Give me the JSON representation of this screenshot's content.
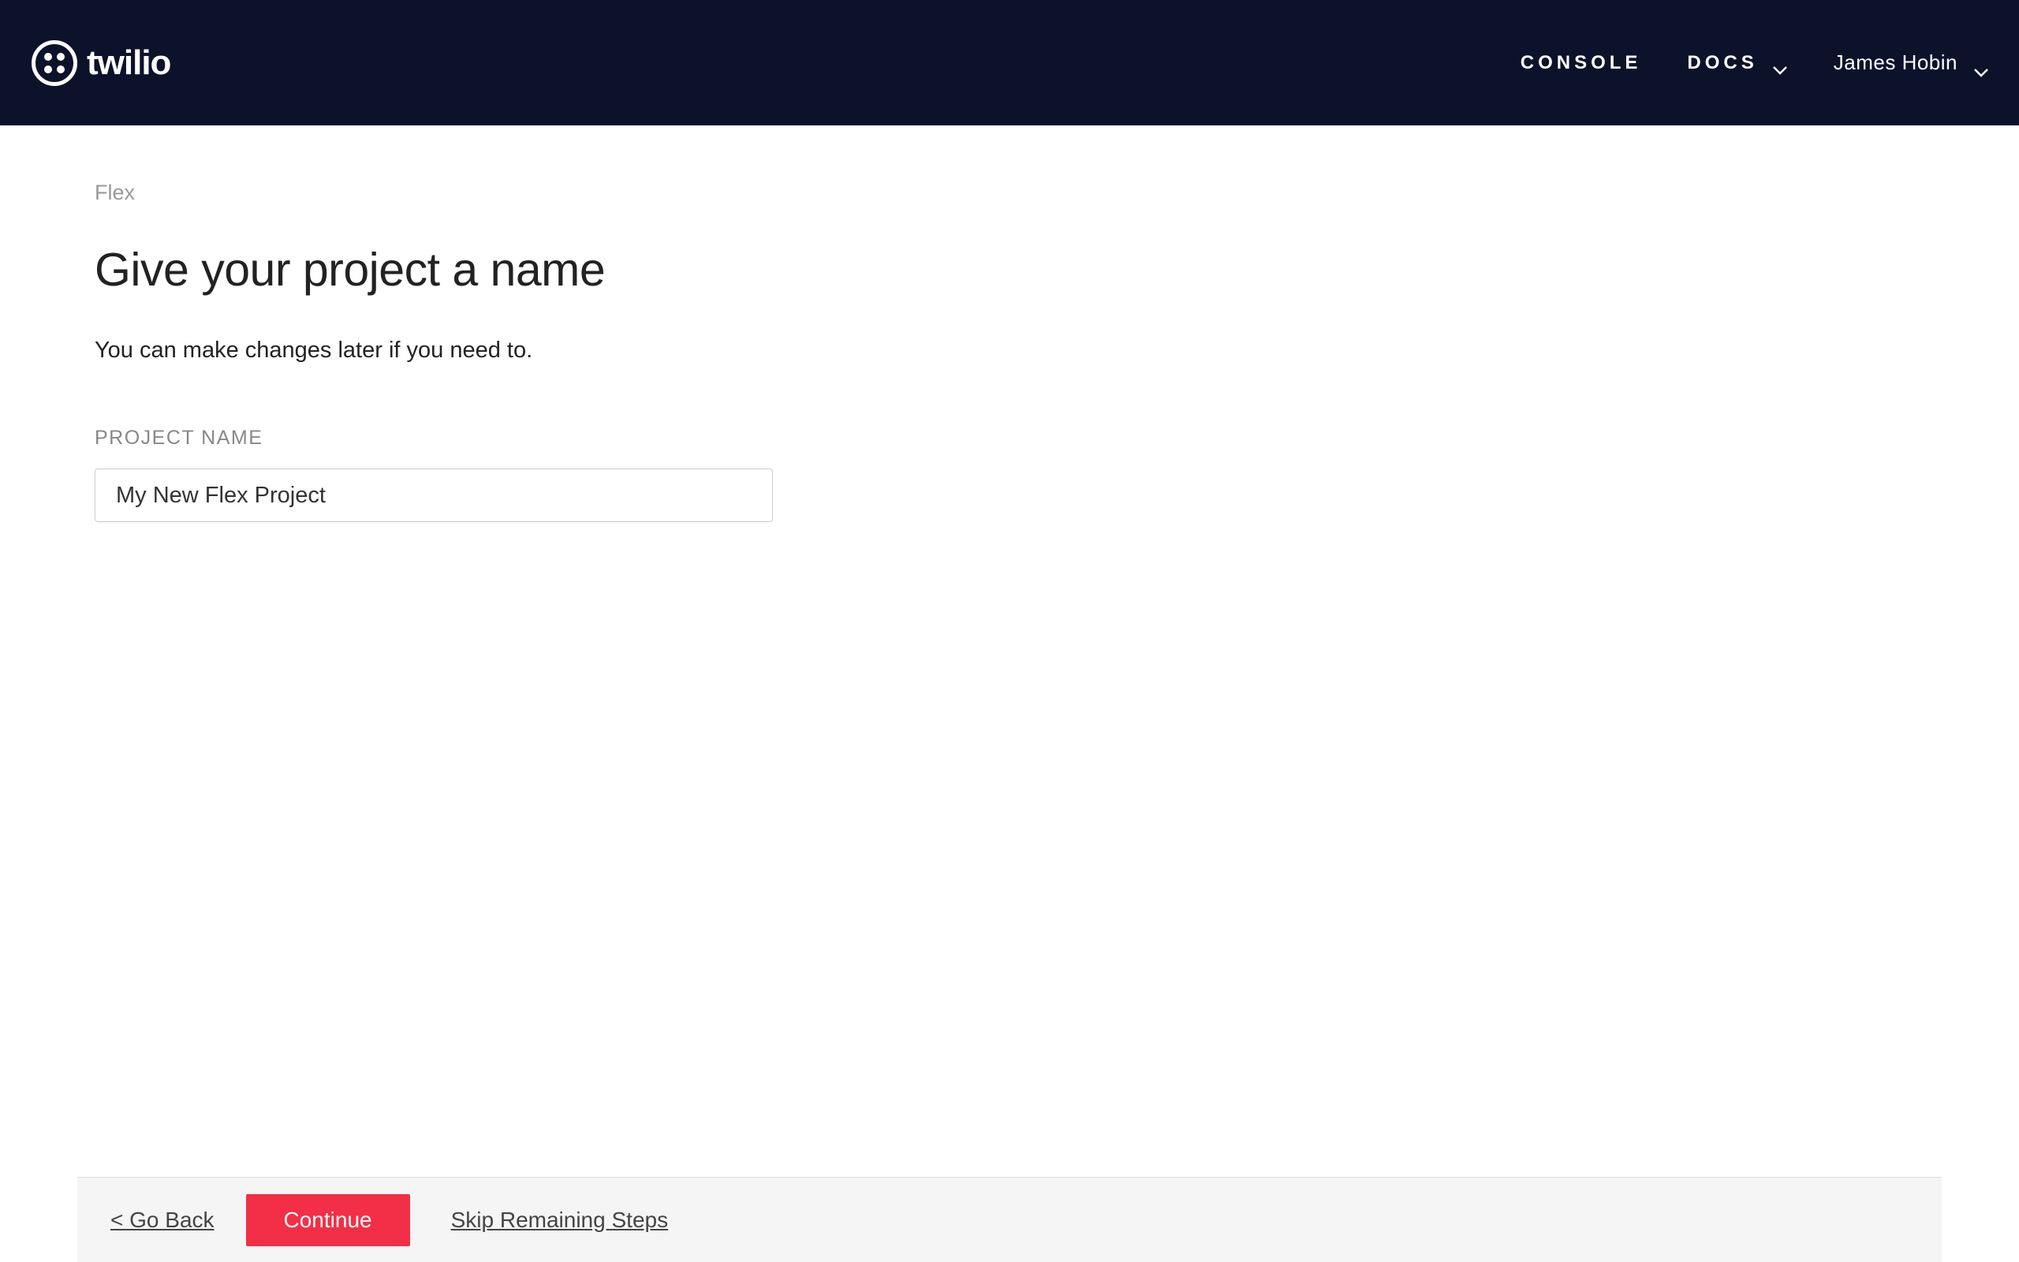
{
  "header": {
    "logo_text": "twilio",
    "nav": {
      "console": "CONSOLE",
      "docs": "DOCS"
    },
    "user_name": "James Hobin"
  },
  "main": {
    "breadcrumb": "Flex",
    "title": "Give your project a name",
    "subtitle": "You can make changes later if you need to.",
    "field_label": "PROJECT NAME",
    "project_name_value": "My New Flex Project"
  },
  "footer": {
    "go_back": "< Go Back",
    "continue": "Continue",
    "skip": "Skip Remaining Steps"
  }
}
